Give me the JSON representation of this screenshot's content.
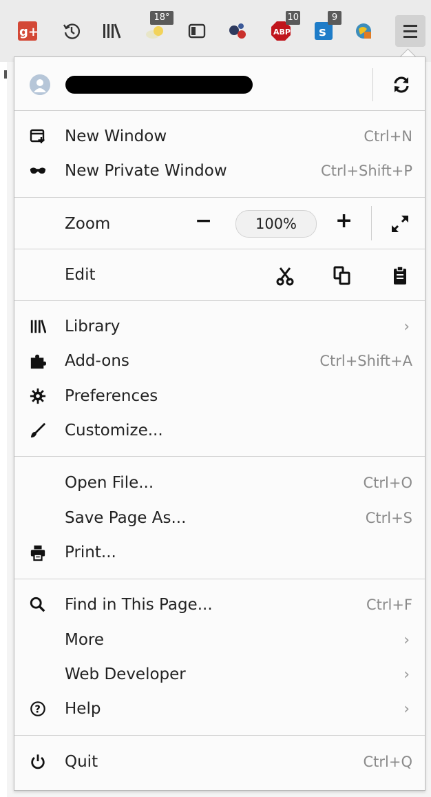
{
  "toolbar": {
    "icons": [
      {
        "name": "google-plus-icon"
      },
      {
        "name": "history-icon"
      },
      {
        "name": "library-icon"
      },
      {
        "name": "weather-icon",
        "badge": "18°"
      },
      {
        "name": "sidebar-icon"
      },
      {
        "name": "extension-molecule-icon"
      },
      {
        "name": "adblock-icon",
        "badge": "10"
      },
      {
        "name": "extension-s-icon",
        "badge": "9"
      },
      {
        "name": "extension-globe-icon"
      }
    ],
    "menu_button": "hamburger-menu-icon"
  },
  "menu": {
    "window": [
      {
        "label": "New Window",
        "shortcut": "Ctrl+N",
        "icon": "new-window-icon"
      },
      {
        "label": "New Private Window",
        "shortcut": "Ctrl+Shift+P",
        "icon": "private-mask-icon"
      }
    ],
    "zoom": {
      "label": "Zoom",
      "value": "100%",
      "minus": "−",
      "plus": "+"
    },
    "edit": {
      "label": "Edit"
    },
    "tools": [
      {
        "label": "Library",
        "icon": "library-icon",
        "submenu": true
      },
      {
        "label": "Add-ons",
        "shortcut": "Ctrl+Shift+A",
        "icon": "puzzle-icon"
      },
      {
        "label": "Preferences",
        "icon": "gear-icon"
      },
      {
        "label": "Customize...",
        "icon": "brush-icon"
      }
    ],
    "file": [
      {
        "label": "Open File...",
        "shortcut": "Ctrl+O"
      },
      {
        "label": "Save Page As...",
        "shortcut": "Ctrl+S"
      },
      {
        "label": "Print...",
        "icon": "printer-icon"
      }
    ],
    "misc": [
      {
        "label": "Find in This Page...",
        "shortcut": "Ctrl+F",
        "icon": "search-icon"
      },
      {
        "label": "More",
        "submenu": true
      },
      {
        "label": "Web Developer",
        "submenu": true
      },
      {
        "label": "Help",
        "icon": "help-icon",
        "submenu": true
      }
    ],
    "quit": {
      "label": "Quit",
      "shortcut": "Ctrl+Q",
      "icon": "power-icon"
    },
    "chevron": "›"
  },
  "colors": {
    "panel_bg": "#fbfbfb",
    "separator": "#cfcfcf",
    "shortcut_text": "#8a8a8a",
    "toolbar_bg": "#ebebeb"
  }
}
